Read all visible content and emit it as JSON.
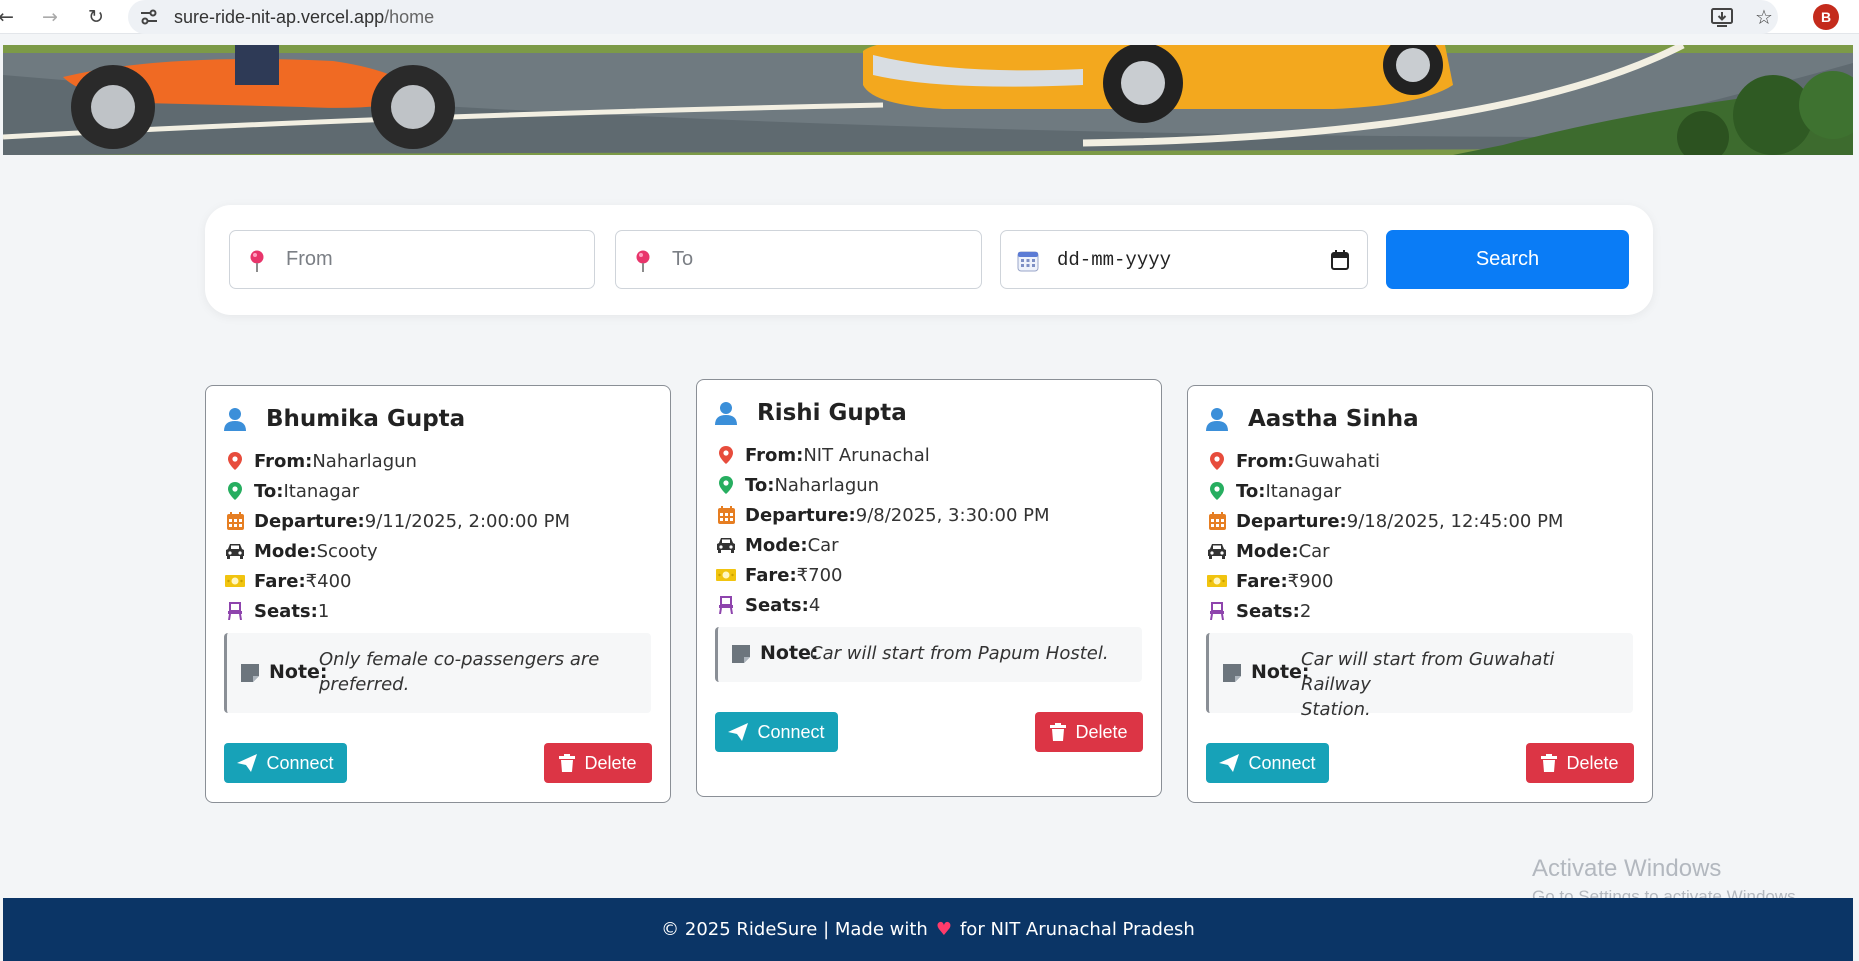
{
  "browser": {
    "url_host": "sure-ride-nit-ap.vercel.app",
    "url_path": "/home",
    "profile_initial": "B",
    "icons": [
      "back-icon",
      "forward-icon",
      "reload-icon",
      "site-info-icon",
      "install-icon",
      "bookmark-star-icon"
    ]
  },
  "search": {
    "from_placeholder": "From",
    "to_placeholder": "To",
    "date_placeholder": "dd-mm-yyyy",
    "button_label": "Search"
  },
  "labels": {
    "from": "From:",
    "to": "To:",
    "departure": "Departure:",
    "mode": "Mode:",
    "fare": "Fare:",
    "seats": "Seats:",
    "note": "Note:",
    "connect": "Connect",
    "delete": "Delete"
  },
  "rides": [
    {
      "name": "Bhumika Gupta",
      "from": "Naharlagun",
      "to": "Itanagar",
      "departure": "9/11/2025, 2:00:00 PM",
      "mode": "Scooty",
      "fare": "₹400",
      "seats": "1",
      "note_line1": "Only female co-passengers are",
      "note_line2": "preferred."
    },
    {
      "name": "Rishi Gupta",
      "from": "NIT Arunachal",
      "to": "Naharlagun",
      "departure": "9/8/2025, 3:30:00 PM",
      "mode": "Car",
      "fare": "₹700",
      "seats": "4",
      "note_line1": "Car will start from Papum Hostel.",
      "note_line2": ""
    },
    {
      "name": "Aastha Sinha",
      "from": "Guwahati",
      "to": "Itanagar",
      "departure": "9/18/2025, 12:45:00 PM",
      "mode": "Car",
      "fare": "₹900",
      "seats": "2",
      "note_line1": "Car will start from Guwahati Railway",
      "note_line2": "Station."
    }
  ],
  "footer": {
    "prefix": "© 2025 RideSure | Made with",
    "heart": "♥",
    "suffix": "for NIT Arunachal Pradesh"
  },
  "watermark": {
    "line1": "Activate Windows",
    "line2": "Go to Settings to activate Windows."
  },
  "colors": {
    "primary": "#0a7cf6",
    "connect": "#17a2b8",
    "delete": "#dc3545",
    "footer": "#0b3566",
    "pin_red": "#e74c3c",
    "pin_green": "#27ae60",
    "calendar": "#e67e22",
    "seat": "#8e44ad",
    "user": "#3b8fd9"
  }
}
